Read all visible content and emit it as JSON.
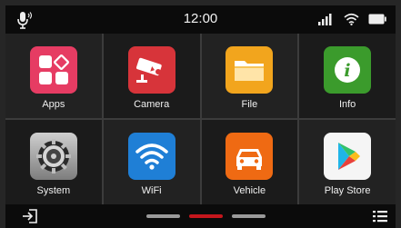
{
  "status_bar": {
    "time": "12:00",
    "icons": [
      "voice-mic-icon",
      "cellular-signal-icon",
      "wifi-icon",
      "battery-icon"
    ]
  },
  "apps": [
    {
      "label": "Apps",
      "icon": "apps-icon",
      "color": "#e63c63"
    },
    {
      "label": "Camera",
      "icon": "security-camera-icon",
      "color": "#d7343a"
    },
    {
      "label": "File",
      "icon": "folder-icon",
      "color": "#f2a51d"
    },
    {
      "label": "Info",
      "icon": "info-icon",
      "color": "#3b9b2c"
    },
    {
      "label": "System",
      "icon": "gear-icon",
      "color": "#8a8a8a"
    },
    {
      "label": "WiFi",
      "icon": "wifi-icon",
      "color": "#1f7fd6"
    },
    {
      "label": "Vehicle",
      "icon": "car-icon",
      "color": "#ef6a13"
    },
    {
      "label": "Play Store",
      "icon": "play-store-icon",
      "color": "#f5f5f5"
    }
  ],
  "bottom_bar": {
    "pages": 3,
    "active_page": 2,
    "left_icon": "exit-icon",
    "right_icon": "menu-list-icon"
  },
  "colors": {
    "accent": "#c4161c",
    "background": "#262626",
    "bar": "#0b0b0b"
  }
}
